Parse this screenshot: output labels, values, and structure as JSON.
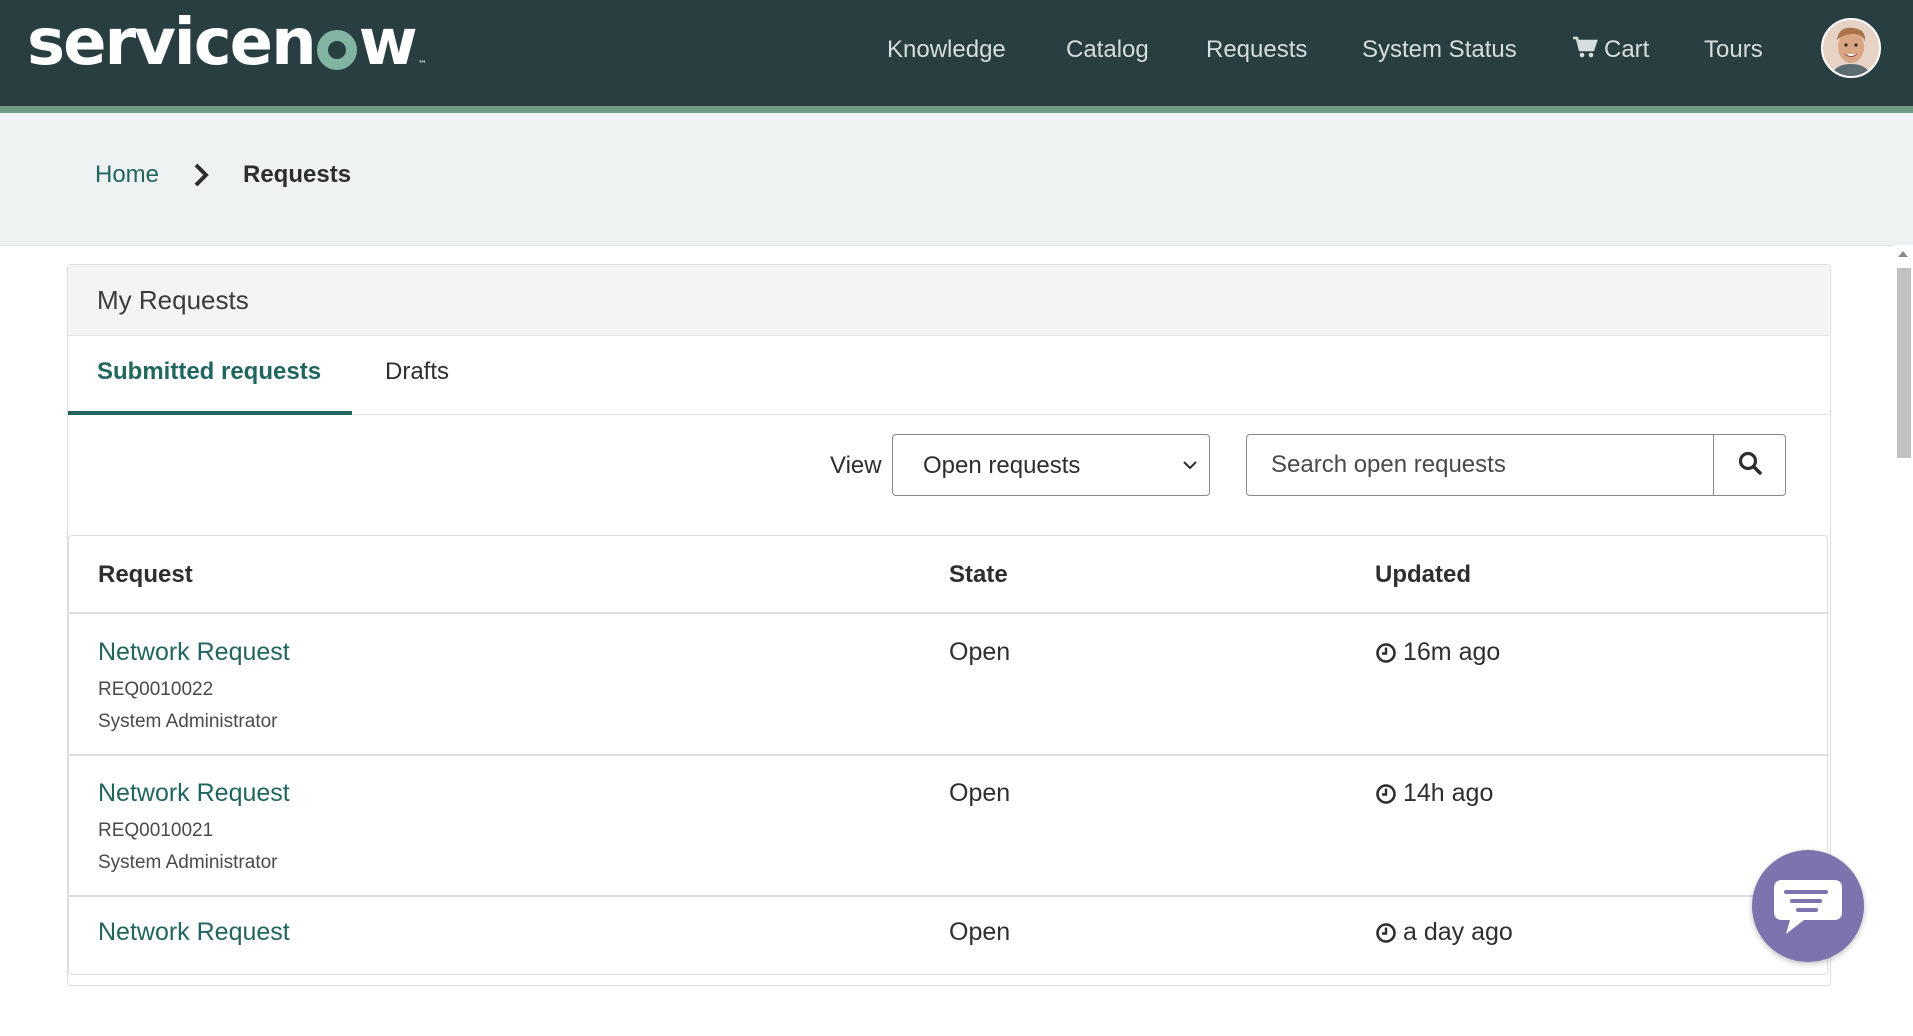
{
  "header": {
    "logo_text": "servicenow",
    "nav": [
      {
        "label": "Knowledge"
      },
      {
        "label": "Catalog"
      },
      {
        "label": "Requests"
      },
      {
        "label": "System Status"
      },
      {
        "label": "Cart",
        "icon": "cart-icon"
      },
      {
        "label": "Tours"
      }
    ],
    "avatar": "user-avatar"
  },
  "breadcrumb": {
    "home": "Home",
    "current": "Requests"
  },
  "panel": {
    "title": "My Requests",
    "tabs": [
      {
        "label": "Submitted requests",
        "active": true
      },
      {
        "label": "Drafts",
        "active": false
      }
    ],
    "view_label": "View",
    "view_selected": "Open requests",
    "search_placeholder": "Search open requests"
  },
  "table": {
    "columns": [
      "Request",
      "State",
      "Updated"
    ],
    "rows": [
      {
        "title": "Network Request",
        "number": "REQ0010022",
        "requested_by": "System Administrator",
        "state": "Open",
        "updated": "16m ago"
      },
      {
        "title": "Network Request",
        "number": "REQ0010021",
        "requested_by": "System Administrator",
        "state": "Open",
        "updated": "14h ago"
      },
      {
        "title": "Network Request",
        "number": "",
        "requested_by": "",
        "state": "Open",
        "updated": "a day ago"
      }
    ]
  },
  "colors": {
    "header_bg": "#293e40",
    "accent": "#21665e",
    "chat": "#7b74ae"
  }
}
